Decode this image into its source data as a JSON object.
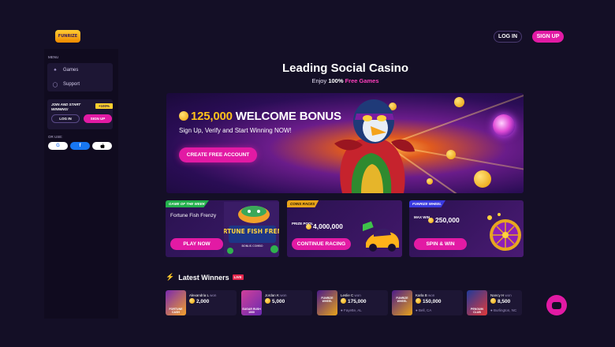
{
  "header": {
    "logo_text": "FUNRIZE",
    "login_label": "LOG IN",
    "signup_label": "SIGN UP"
  },
  "sidebar": {
    "menu_label": "MENU",
    "items": [
      {
        "label": "Games",
        "icon": "games-icon"
      },
      {
        "label": "Support",
        "icon": "support-icon"
      }
    ],
    "join_text": "JOIN AND START WINNING!",
    "join_badge": "+100%",
    "join_login": "LOG IN",
    "join_signup": "SIGN UP",
    "or_label": "OR USE:",
    "social": [
      {
        "label": "G",
        "icon": "google-icon"
      },
      {
        "label": "f",
        "icon": "facebook-icon"
      },
      {
        "label": "",
        "icon": "apple-icon"
      }
    ]
  },
  "hero": {
    "title": "Leading Social Casino",
    "sub_prefix": "Enjoy ",
    "sub_bold": "100%",
    "sub_pink": " Free Games"
  },
  "banner": {
    "amount": "125,000",
    "headline": " WELCOME BONUS",
    "subtitle": "Sign Up, Verify and Start Winning NOW!",
    "cta": "CREATE FREE ACCOUNT"
  },
  "cards": [
    {
      "tag": "GAME OF THE WEEK",
      "title": "Fortune Fish Frenzy",
      "cta": "PLAY NOW",
      "art_text": "FORTUNE FISH FRENZY",
      "art_sub": "BONUS COMBO"
    },
    {
      "tag": "COINS RACES",
      "pool_label": "PRIZE POOL",
      "pool_value": "4,000,000",
      "cta": "CONTINUE RACING"
    },
    {
      "tag": "FUNRIZE WHEEL",
      "pool_label": "MAX WIN",
      "pool_value": "250,000",
      "cta": "SPIN & WIN"
    }
  ],
  "winners": {
    "title": "Latest Winners",
    "live_label": "LIVE",
    "items": [
      {
        "name": "Alexandria L",
        "won": "won",
        "amount": "2,000",
        "location": "",
        "game": "FORTUNE CASH"
      },
      {
        "name": "Jordan K",
        "won": "won",
        "amount": "5,000",
        "location": "",
        "game": "SUGAR RUSH 1000"
      },
      {
        "name": "Leslie C",
        "won": "won",
        "amount": "175,000",
        "location": "Fayette, AL",
        "game": "FUNRIZE WHEEL"
      },
      {
        "name": "Karla B",
        "won": "won",
        "amount": "150,000",
        "location": "Bell, CA",
        "game": "FUNRIZE WHEEL"
      },
      {
        "name": "Nancy H",
        "won": "won",
        "amount": "8,500",
        "location": "Burlington, NC",
        "game": "PENGUIN CLUB"
      }
    ]
  },
  "colors": {
    "accent": "#e21aa4",
    "gold": "#ffc21a",
    "background": "#140f26",
    "sidebar": "#100b1f",
    "card": "#1d1634"
  }
}
